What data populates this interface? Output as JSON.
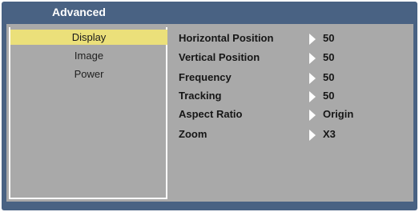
{
  "window": {
    "title": "Advanced"
  },
  "sidebar": {
    "items": [
      {
        "label": "Display",
        "selected": true
      },
      {
        "label": "Image",
        "selected": false
      },
      {
        "label": "Power",
        "selected": false
      }
    ]
  },
  "settings": {
    "rows": [
      {
        "label": "Horizontal Position",
        "value": "50"
      },
      {
        "label": "Vertical Position",
        "value": "50"
      },
      {
        "label": "Frequency",
        "value": "50"
      },
      {
        "label": "Tracking",
        "value": "50"
      },
      {
        "label": "Aspect Ratio",
        "value": "Origin"
      },
      {
        "label": "Zoom",
        "value": "X3"
      }
    ]
  },
  "colors": {
    "frame": "#496283",
    "panel": "#a9a9a9",
    "selected": "#ebe07a",
    "text": "#161616",
    "title_text": "#ffffff",
    "arrow": "#ffffff"
  }
}
